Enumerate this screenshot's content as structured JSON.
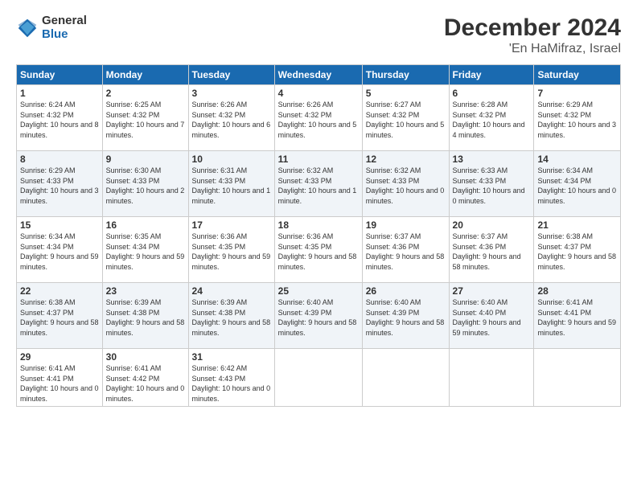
{
  "logo": {
    "general": "General",
    "blue": "Blue"
  },
  "header": {
    "month": "December 2024",
    "location": "'En HaMifraz, Israel"
  },
  "weekdays": [
    "Sunday",
    "Monday",
    "Tuesday",
    "Wednesday",
    "Thursday",
    "Friday",
    "Saturday"
  ],
  "weeks": [
    [
      {
        "day": "1",
        "sunrise": "6:24 AM",
        "sunset": "4:32 PM",
        "daylight": "10 hours and 8 minutes."
      },
      {
        "day": "2",
        "sunrise": "6:25 AM",
        "sunset": "4:32 PM",
        "daylight": "10 hours and 7 minutes."
      },
      {
        "day": "3",
        "sunrise": "6:26 AM",
        "sunset": "4:32 PM",
        "daylight": "10 hours and 6 minutes."
      },
      {
        "day": "4",
        "sunrise": "6:26 AM",
        "sunset": "4:32 PM",
        "daylight": "10 hours and 5 minutes."
      },
      {
        "day": "5",
        "sunrise": "6:27 AM",
        "sunset": "4:32 PM",
        "daylight": "10 hours and 5 minutes."
      },
      {
        "day": "6",
        "sunrise": "6:28 AM",
        "sunset": "4:32 PM",
        "daylight": "10 hours and 4 minutes."
      },
      {
        "day": "7",
        "sunrise": "6:29 AM",
        "sunset": "4:32 PM",
        "daylight": "10 hours and 3 minutes."
      }
    ],
    [
      {
        "day": "8",
        "sunrise": "6:29 AM",
        "sunset": "4:33 PM",
        "daylight": "10 hours and 3 minutes."
      },
      {
        "day": "9",
        "sunrise": "6:30 AM",
        "sunset": "4:33 PM",
        "daylight": "10 hours and 2 minutes."
      },
      {
        "day": "10",
        "sunrise": "6:31 AM",
        "sunset": "4:33 PM",
        "daylight": "10 hours and 1 minute."
      },
      {
        "day": "11",
        "sunrise": "6:32 AM",
        "sunset": "4:33 PM",
        "daylight": "10 hours and 1 minute."
      },
      {
        "day": "12",
        "sunrise": "6:32 AM",
        "sunset": "4:33 PM",
        "daylight": "10 hours and 0 minutes."
      },
      {
        "day": "13",
        "sunrise": "6:33 AM",
        "sunset": "4:33 PM",
        "daylight": "10 hours and 0 minutes."
      },
      {
        "day": "14",
        "sunrise": "6:34 AM",
        "sunset": "4:34 PM",
        "daylight": "10 hours and 0 minutes."
      }
    ],
    [
      {
        "day": "15",
        "sunrise": "6:34 AM",
        "sunset": "4:34 PM",
        "daylight": "9 hours and 59 minutes."
      },
      {
        "day": "16",
        "sunrise": "6:35 AM",
        "sunset": "4:34 PM",
        "daylight": "9 hours and 59 minutes."
      },
      {
        "day": "17",
        "sunrise": "6:36 AM",
        "sunset": "4:35 PM",
        "daylight": "9 hours and 59 minutes."
      },
      {
        "day": "18",
        "sunrise": "6:36 AM",
        "sunset": "4:35 PM",
        "daylight": "9 hours and 58 minutes."
      },
      {
        "day": "19",
        "sunrise": "6:37 AM",
        "sunset": "4:36 PM",
        "daylight": "9 hours and 58 minutes."
      },
      {
        "day": "20",
        "sunrise": "6:37 AM",
        "sunset": "4:36 PM",
        "daylight": "9 hours and 58 minutes."
      },
      {
        "day": "21",
        "sunrise": "6:38 AM",
        "sunset": "4:37 PM",
        "daylight": "9 hours and 58 minutes."
      }
    ],
    [
      {
        "day": "22",
        "sunrise": "6:38 AM",
        "sunset": "4:37 PM",
        "daylight": "9 hours and 58 minutes."
      },
      {
        "day": "23",
        "sunrise": "6:39 AM",
        "sunset": "4:38 PM",
        "daylight": "9 hours and 58 minutes."
      },
      {
        "day": "24",
        "sunrise": "6:39 AM",
        "sunset": "4:38 PM",
        "daylight": "9 hours and 58 minutes."
      },
      {
        "day": "25",
        "sunrise": "6:40 AM",
        "sunset": "4:39 PM",
        "daylight": "9 hours and 58 minutes."
      },
      {
        "day": "26",
        "sunrise": "6:40 AM",
        "sunset": "4:39 PM",
        "daylight": "9 hours and 58 minutes."
      },
      {
        "day": "27",
        "sunrise": "6:40 AM",
        "sunset": "4:40 PM",
        "daylight": "9 hours and 59 minutes."
      },
      {
        "day": "28",
        "sunrise": "6:41 AM",
        "sunset": "4:41 PM",
        "daylight": "9 hours and 59 minutes."
      }
    ],
    [
      {
        "day": "29",
        "sunrise": "6:41 AM",
        "sunset": "4:41 PM",
        "daylight": "10 hours and 0 minutes."
      },
      {
        "day": "30",
        "sunrise": "6:41 AM",
        "sunset": "4:42 PM",
        "daylight": "10 hours and 0 minutes."
      },
      {
        "day": "31",
        "sunrise": "6:42 AM",
        "sunset": "4:43 PM",
        "daylight": "10 hours and 0 minutes."
      },
      null,
      null,
      null,
      null
    ]
  ],
  "labels": {
    "sunrise": "Sunrise:",
    "sunset": "Sunset:",
    "daylight": "Daylight:"
  }
}
